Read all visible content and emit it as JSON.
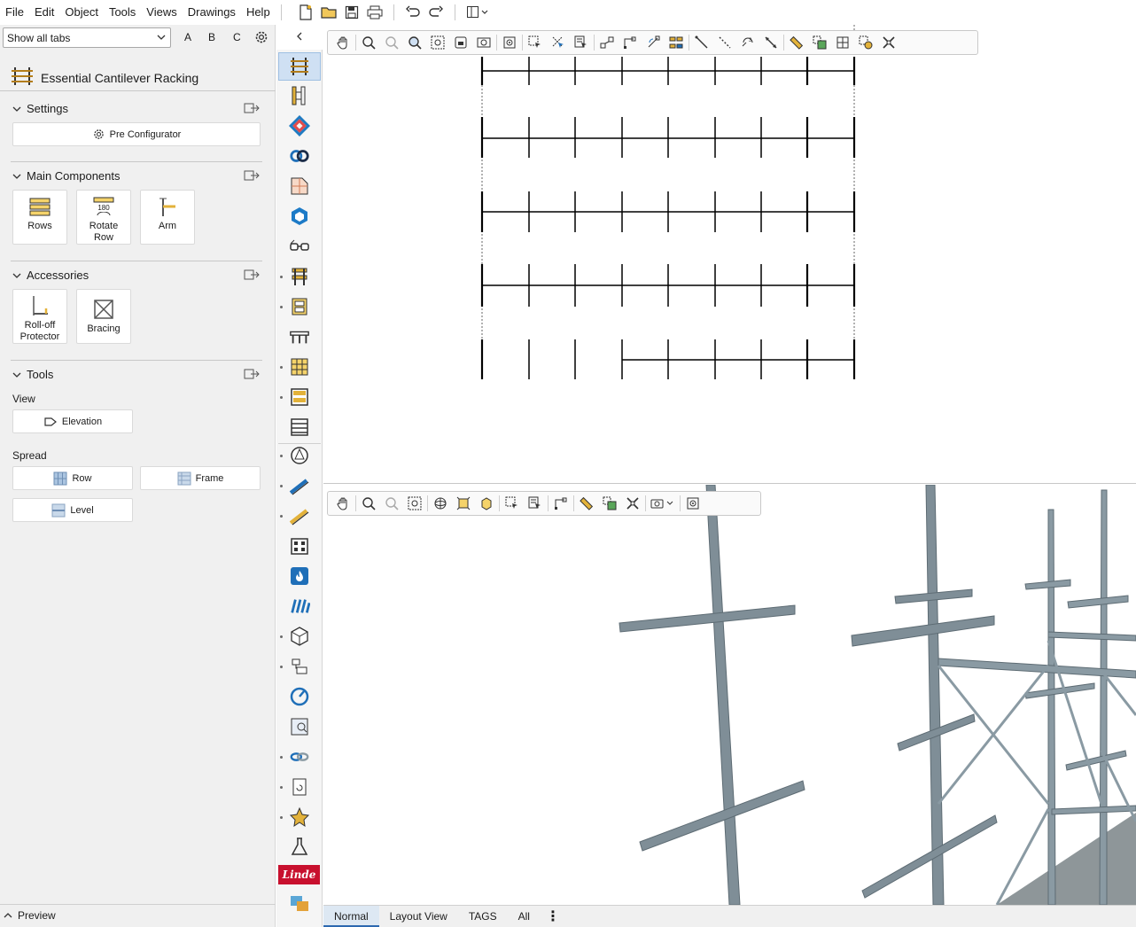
{
  "menubar": {
    "items": [
      "File",
      "Edit",
      "Object",
      "Tools",
      "Views",
      "Drawings",
      "Help"
    ],
    "toolbar_icons": [
      "new-file-icon",
      "open-folder-icon",
      "save-icon",
      "print-icon",
      "undo-icon",
      "redo-icon",
      "layout-icon"
    ]
  },
  "leftpanel": {
    "tab_filter": "Show all tabs",
    "letters": [
      "A",
      "B",
      "C"
    ],
    "title": "Essential Cantilever Racking",
    "settings": {
      "heading": "Settings",
      "pre_configurator": "Pre Configurator"
    },
    "main_components": {
      "heading": "Main Components",
      "rows": "Rows",
      "rotate_row_1": "Rotate",
      "rotate_row_2": "Row",
      "rotate_badge": "180",
      "arm": "Arm"
    },
    "accessories": {
      "heading": "Accessories",
      "rolloff_1": "Roll-off",
      "rolloff_2": "Protector",
      "bracing": "Bracing"
    },
    "tools": {
      "heading": "Tools",
      "view_label": "View",
      "elevation": "Elevation",
      "spread_label": "Spread",
      "row": "Row",
      "frame": "Frame",
      "level": "Level"
    },
    "preview": "Preview"
  },
  "bottomtabs": {
    "tabs": [
      "Normal",
      "Layout View",
      "TAGS",
      "All"
    ],
    "active": "Normal"
  },
  "colors": {
    "accent": "#2c68b0",
    "linde": "#c8102e",
    "steel": "#8a9aa3"
  },
  "linde_logo": "Linde"
}
